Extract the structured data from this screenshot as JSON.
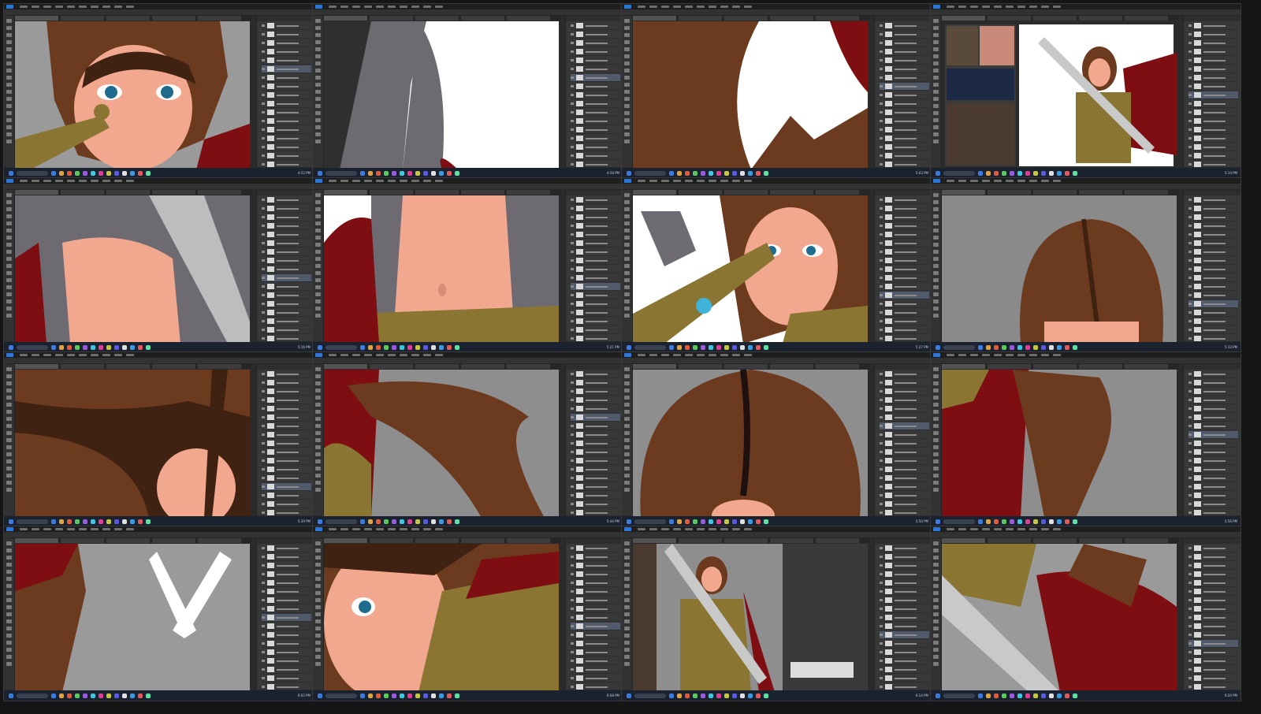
{
  "title": "",
  "colors": {
    "bg": "#151515",
    "skin": "#f2a88f",
    "skin_shade": "#d98b76",
    "hair": "#6b3a1f",
    "hair_dark": "#3f2212",
    "armor_gold": "#8a7632",
    "cape": "#7e0e12",
    "sword": "#c9c9c9",
    "glove": "#6d6a72",
    "bg_gray": "#8e8e8e",
    "eye": "#1f6b8e",
    "gem": "#3fb3d9"
  },
  "tiles": [
    {
      "scene": "face-closeup",
      "time": "4:52 PM"
    },
    {
      "scene": "wing-lineart",
      "time": "4:58 PM"
    },
    {
      "scene": "hair-mask",
      "time": "5:03 PM"
    },
    {
      "scene": "full-figure-refs",
      "time": "5:10 PM"
    },
    {
      "scene": "torso-sketch",
      "time": "5:16 PM"
    },
    {
      "scene": "abdomen",
      "time": "5:21 PM"
    },
    {
      "scene": "face-sword",
      "time": "5:27 PM"
    },
    {
      "scene": "hair-top",
      "time": "5:33 PM"
    },
    {
      "scene": "hair-strands",
      "time": "5:39 PM"
    },
    {
      "scene": "hair-flow",
      "time": "5:44 PM"
    },
    {
      "scene": "hair-crown",
      "time": "5:50 PM"
    },
    {
      "scene": "cape-hair",
      "time": "5:56 PM"
    },
    {
      "scene": "ribbon",
      "time": "6:02 PM"
    },
    {
      "scene": "face-armor",
      "time": "6:08 PM"
    },
    {
      "scene": "brushes-panel",
      "time": "6:14 PM"
    },
    {
      "scene": "sword-cape",
      "time": "6:20 PM"
    }
  ]
}
